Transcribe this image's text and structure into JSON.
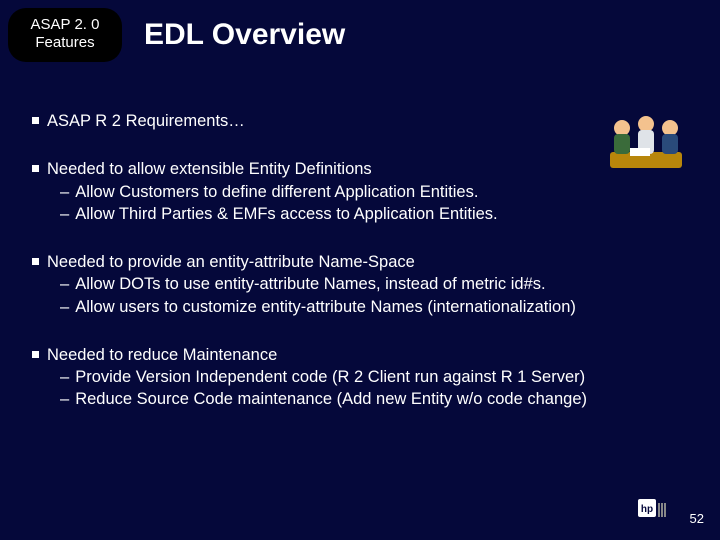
{
  "header": {
    "badge_line1": "ASAP 2. 0",
    "badge_line2": "Features",
    "title": "EDL Overview"
  },
  "bullets": [
    {
      "text": "ASAP R 2 Requirements…",
      "subs": []
    },
    {
      "text": "Needed to allow extensible Entity Definitions",
      "subs": [
        "Allow Customers to define different Application Entities.",
        "Allow Third Parties & EMFs access to Application Entities."
      ]
    },
    {
      "text": "Needed to provide an entity-attribute Name-Space",
      "subs": [
        "Allow DOTs to use entity-attribute Names, instead of metric id#s.",
        "Allow users to customize entity-attribute Names (internationalization)"
      ]
    },
    {
      "text": "Needed to reduce Maintenance",
      "subs": [
        "Provide Version Independent code (R 2 Client run against R 1 Server)",
        "Reduce Source Code maintenance (Add new Entity w/o code change)"
      ]
    }
  ],
  "page_number": "52",
  "logo_label": "hp"
}
